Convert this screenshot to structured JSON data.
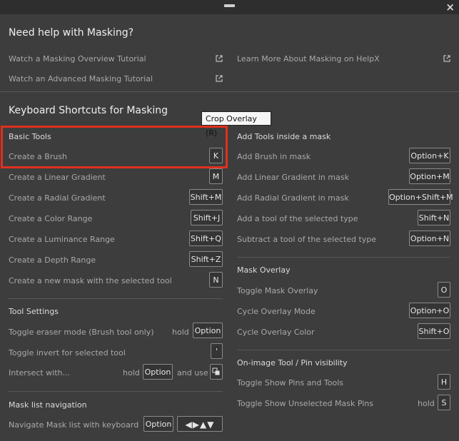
{
  "window": {
    "close_icon": "×"
  },
  "help": {
    "title": "Need help with Masking?",
    "links": [
      {
        "label": "Watch a Masking Overview Tutorial"
      },
      {
        "label": "Watch an Advanced Masking Tutorial"
      },
      {
        "label": "Learn More About Masking on HelpX"
      }
    ]
  },
  "shortcuts": {
    "title": "Keyboard Shortcuts for Masking",
    "basic_tools": {
      "heading": "Basic Tools",
      "items": [
        {
          "label": "Create a Brush",
          "key": "K"
        },
        {
          "label": "Create a Linear Gradient",
          "key": "M"
        },
        {
          "label": "Create a Radial Gradient",
          "key": "Shift+M"
        },
        {
          "label": "Create a Color Range",
          "key": "Shift+J"
        },
        {
          "label": "Create a Luminance Range",
          "key": "Shift+Q"
        },
        {
          "label": "Create a Depth Range",
          "key": "Shift+Z"
        },
        {
          "label": "Create a new mask with the selected tool",
          "key": "N"
        }
      ]
    },
    "tool_settings": {
      "heading": "Tool Settings",
      "items": [
        {
          "label": "Toggle eraser mode (Brush tool only)",
          "prefix": "hold",
          "key": "Option"
        },
        {
          "label": "Toggle invert for selected tool",
          "key": "'"
        },
        {
          "label": "Intersect with...",
          "prefix": "hold",
          "key": "Option",
          "suffix": "and use"
        }
      ]
    },
    "mask_list": {
      "heading": "Mask list navigation",
      "items": [
        {
          "label": "Navigate Mask list with keyboard",
          "key": "Option",
          "arrows": "◀▶▲▼"
        }
      ]
    },
    "add_tools": {
      "heading": "Add Tools inside a mask",
      "items": [
        {
          "label": "Add Brush in mask",
          "key": "Option+K"
        },
        {
          "label": "Add Linear Gradient in mask",
          "key": "Option+M"
        },
        {
          "label": "Add Radial Gradient in mask",
          "key": "Option+Shift+M"
        },
        {
          "label": "Add a tool of the selected type",
          "key": "Shift+N"
        },
        {
          "label": "Subtract a tool of the selected type",
          "key": "Option+N"
        }
      ]
    },
    "mask_overlay": {
      "heading": "Mask Overlay",
      "items": [
        {
          "label": "Toggle Mask Overlay",
          "key": "O"
        },
        {
          "label": "Cycle Overlay Mode",
          "key": "Option+O"
        },
        {
          "label": "Cycle Overlay Color",
          "key": "Shift+O"
        }
      ]
    },
    "pin_visibility": {
      "heading": "On-image Tool / Pin visibility",
      "items": [
        {
          "label": "Toggle Show Pins and Tools",
          "key": "H"
        },
        {
          "label": "Toggle Show Unselected Mask Pins",
          "prefix": "hold",
          "key": "S"
        }
      ]
    }
  },
  "tooltip": {
    "text": "Crop Overlay (R)"
  },
  "colors": {
    "background": "#3d3d3d",
    "highlight": "#e0301e"
  }
}
